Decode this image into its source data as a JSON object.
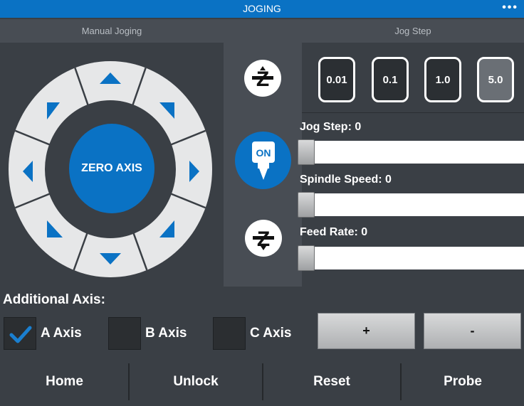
{
  "titlebar": {
    "title": "JOGING",
    "menu_glyph": "•••"
  },
  "panels": {
    "manual_jog": "Manual Joging",
    "jog_step": "Jog Step"
  },
  "jog": {
    "zero_axis_label": "ZERO AXIS",
    "accent": "#0a72c4",
    "ring_color": "#e6e7e8"
  },
  "z_controls": {
    "up_icon": "z-up-icon",
    "down_icon": "z-down-icon",
    "spindle_label": "ON"
  },
  "steps": [
    "0.01",
    "0.1",
    "1.0",
    "5.0"
  ],
  "selected_step": "5.0",
  "sliders": [
    {
      "label": "Jog Step: 0",
      "value": 0
    },
    {
      "label": "Spindle Speed: 0",
      "value": 0
    },
    {
      "label": "Feed Rate: 0",
      "value": 0
    }
  ],
  "additional_axis": {
    "label": "Additional Axis:",
    "axes": [
      {
        "label": "A Axis",
        "checked": true
      },
      {
        "label": "B Axis",
        "checked": false
      },
      {
        "label": "C Axis",
        "checked": false
      }
    ],
    "plus_label": "+",
    "minus_label": "-"
  },
  "bottom": {
    "home": "Home",
    "unlock": "Unlock",
    "reset": "Reset",
    "probe": "Probe"
  }
}
